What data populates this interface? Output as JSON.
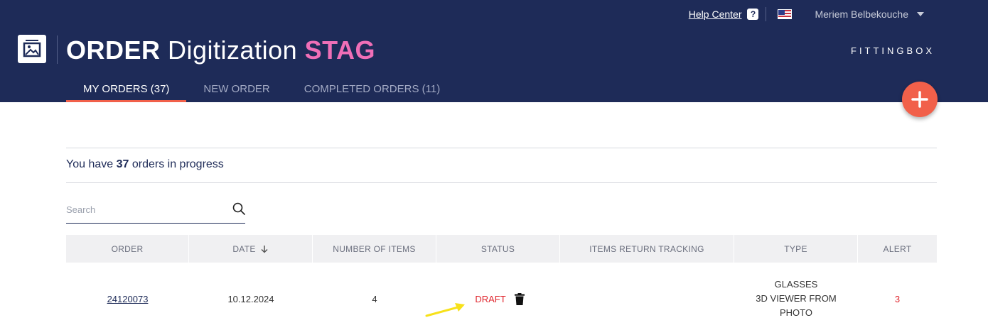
{
  "topbar": {
    "help_label": "Help Center",
    "help_icon": "?",
    "flag": "us-flag",
    "user_name": "Meriem Belbekouche"
  },
  "app": {
    "title_order": "ORDER",
    "title_digitization": "Digitization",
    "title_env": "STAG",
    "brand": "FITTINGBOX",
    "colors": {
      "header": "#1e2b58",
      "accent": "#f1604a",
      "env": "#f06fb7",
      "alert": "#e0272f"
    }
  },
  "tabs": [
    {
      "label": "MY ORDERS (37)",
      "active": true
    },
    {
      "label": "NEW ORDER",
      "active": false
    },
    {
      "label": "COMPLETED ORDERS (11)",
      "active": false
    }
  ],
  "fab": {
    "icon": "plus-icon"
  },
  "summary": {
    "prefix": "You have",
    "count": "37",
    "suffix": "orders in progress"
  },
  "search": {
    "placeholder": "Search",
    "value": ""
  },
  "table": {
    "columns": [
      "ORDER",
      "DATE",
      "NUMBER OF ITEMS",
      "STATUS",
      "ITEMS RETURN TRACKING",
      "TYPE",
      "ALERT"
    ],
    "sort_column": "DATE",
    "rows": [
      {
        "order": "24120073",
        "date": "10.12.2024",
        "items": "4",
        "status": "DRAFT",
        "tracking": "",
        "type_lines": [
          "GLASSES",
          "3D VIEWER FROM",
          "PHOTO"
        ],
        "alert": "3"
      }
    ]
  }
}
